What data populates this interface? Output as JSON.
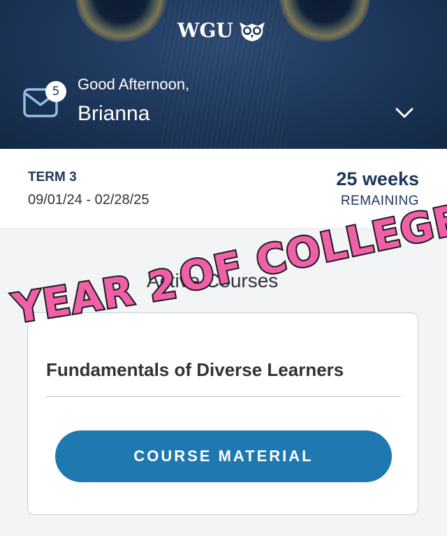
{
  "header": {
    "logo_text": "WGU",
    "greeting": "Good Afternoon,",
    "user_name": "Brianna",
    "mail_count": "5",
    "icons": [
      "owl-logo-icon",
      "mail-icon",
      "chevron-down-icon"
    ]
  },
  "term": {
    "label": "TERM 3",
    "dates": "09/01/24 - 02/28/25",
    "weeks": "25 weeks",
    "remaining_label": "REMAINING"
  },
  "courses": {
    "section_title": "Active Courses",
    "items": [
      {
        "name": "Fundamentals of Diverse Learners",
        "button_label": "COURSE MATERIAL"
      }
    ]
  },
  "overlay": {
    "line1": "OF COLLEGE",
    "line2": "YEAR 2",
    "fill_color": "#f060a8",
    "outline_color": "#1a1a1a"
  },
  "colors": {
    "header_bg": "#1d3659",
    "accent_blue": "#1f78b0",
    "navy_text": "#1d3659"
  }
}
